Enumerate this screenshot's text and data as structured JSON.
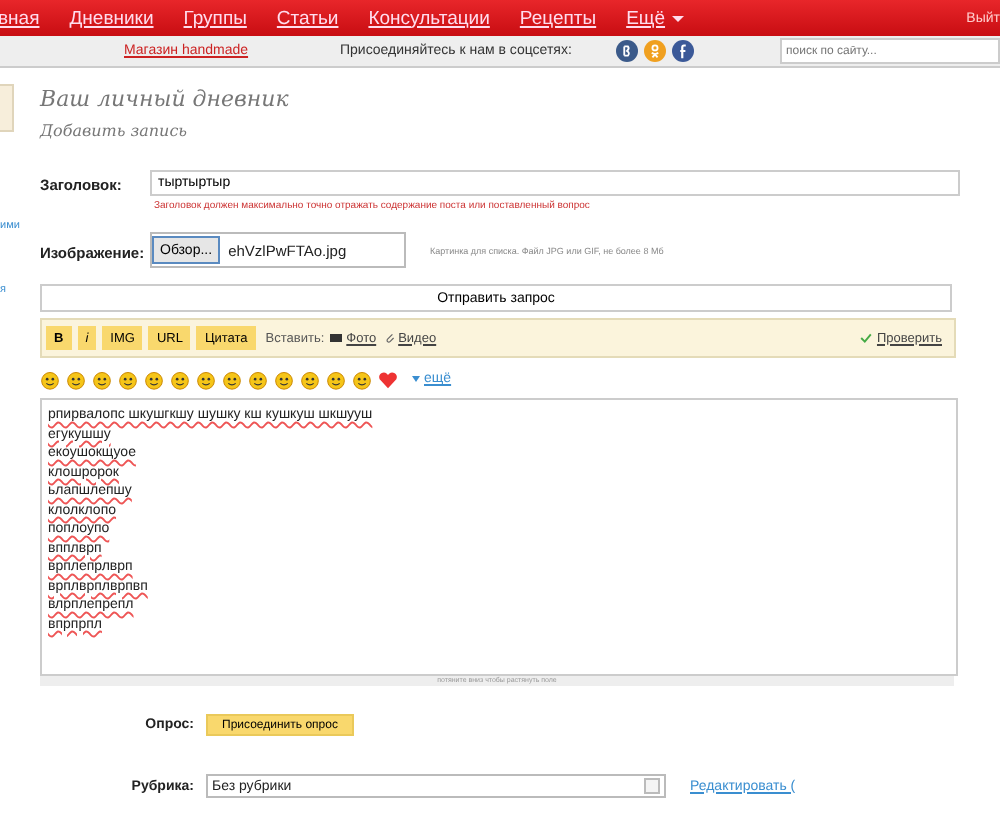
{
  "nav": {
    "items": [
      {
        "label": "вная",
        "selected": false
      },
      {
        "label": "Дневники",
        "selected": false
      },
      {
        "label": "Группы",
        "selected": false
      },
      {
        "label": "Статьи",
        "selected": false
      },
      {
        "label": "Консультации",
        "selected": false
      },
      {
        "label": "Рецепты",
        "selected": false
      },
      {
        "label": "Ещё",
        "selected": false
      }
    ],
    "right": "Выйт"
  },
  "subbar": {
    "shop_link": "Магазин handmade",
    "social_label": "Присоединяйтесь к нам в соцсетях:",
    "social": [
      {
        "kind": "vk",
        "color": "#3b5a8a"
      },
      {
        "kind": "ok",
        "color": "#f0a020"
      },
      {
        "kind": "fb",
        "color": "#3b5998"
      }
    ],
    "search": {
      "placeholder": "поиск по сайту..."
    }
  },
  "sidebar": {
    "links": [
      "ими",
      "я"
    ]
  },
  "page_title": "Ваш личный дневник",
  "subtitle": "Добавить запись",
  "form": {
    "title_label": "Заголовок:",
    "title_value": "тыртыртыр",
    "title_hint": "Заголовок должен максимально точно отражать содержание поста или поставленный вопрос",
    "image_label": "Изображение:",
    "browse_button": "Обзор...",
    "file_name": "ehVzlPwFTAo.jpg",
    "image_hint": "Картинка для списка. Файл JPG или GIF, не более 8 Мб",
    "submit_bar": "Отправить запрос",
    "toolbar": {
      "buttons": [
        "B",
        "i",
        "IMG",
        "URL",
        "Цитата"
      ],
      "insert_label": "Вставить:",
      "photo_link": "Фото",
      "video_link": "Видео",
      "check_link": "Проверить"
    },
    "smileys_more": "ещё",
    "body_lines": [
      "рпирвалопс шкушгкшу шушку кш кушкуш шкшууш",
      "егукушшу",
      "екоушокщуое",
      "клошророк",
      "ьлапшлепшу",
      "клолклопо",
      "поплоупо",
      "впплврп",
      "врплепрлврп",
      "врплврплврпвп",
      "влрплепрепл",
      "впрпрпл"
    ],
    "resize_hint": "потяните вниз чтобы растянуть поле",
    "poll_label": "Опрос:",
    "poll_button": "Присоединить опрос",
    "rubric_label": "Рубрика:",
    "rubric_value": "Без рубрики",
    "rubric_link": "Редактировать ("
  }
}
